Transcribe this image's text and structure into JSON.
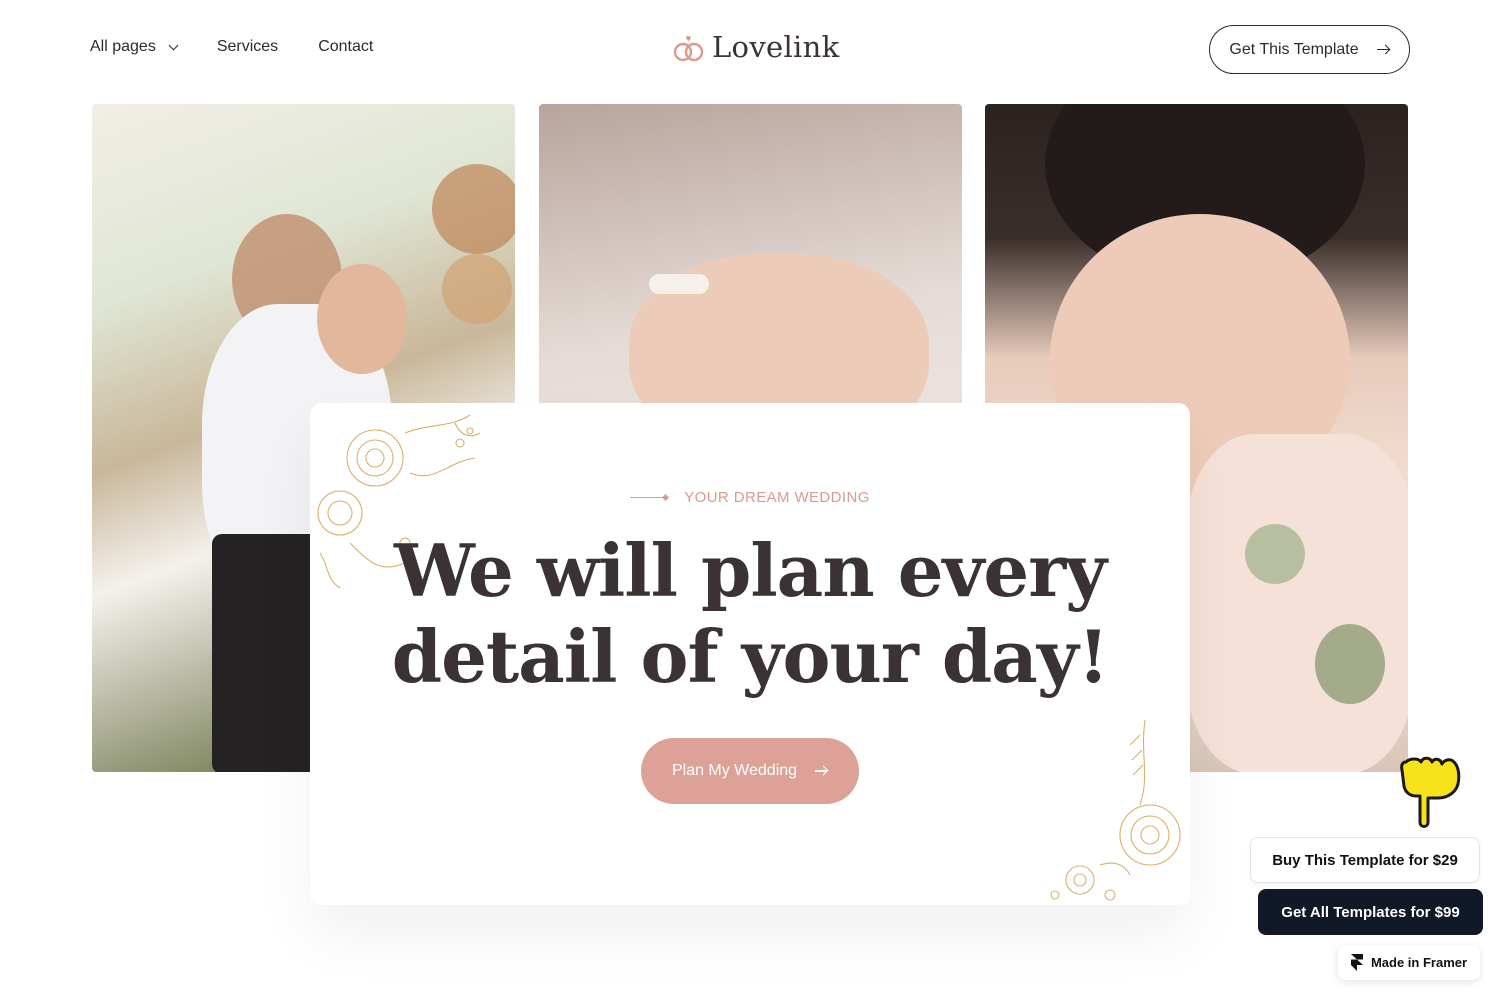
{
  "nav": {
    "links": [
      {
        "label": "All pages"
      },
      {
        "label": "Services"
      },
      {
        "label": "Contact"
      }
    ],
    "logo_text": "Lovelink",
    "cta_label": "Get This Template"
  },
  "hero": {
    "eyebrow": "YOUR DREAM WEDDING",
    "headline_line1": "We will plan every",
    "headline_line2": "detail of your day!",
    "cta_label": "Plan My Wedding"
  },
  "promo": {
    "buy_label": "Buy This Template for $29",
    "all_label": "Get All Templates for $99",
    "framer_label": "Made in Framer"
  },
  "colors": {
    "accent": "#dea198",
    "text": "#3b3333",
    "dark_button": "#111827"
  },
  "icons": {
    "logo": "rings-icon",
    "dropdown": "chevron-down-icon",
    "arrow": "arrow-right-icon",
    "pointer": "pointing-hand-icon",
    "framer": "framer-icon"
  }
}
